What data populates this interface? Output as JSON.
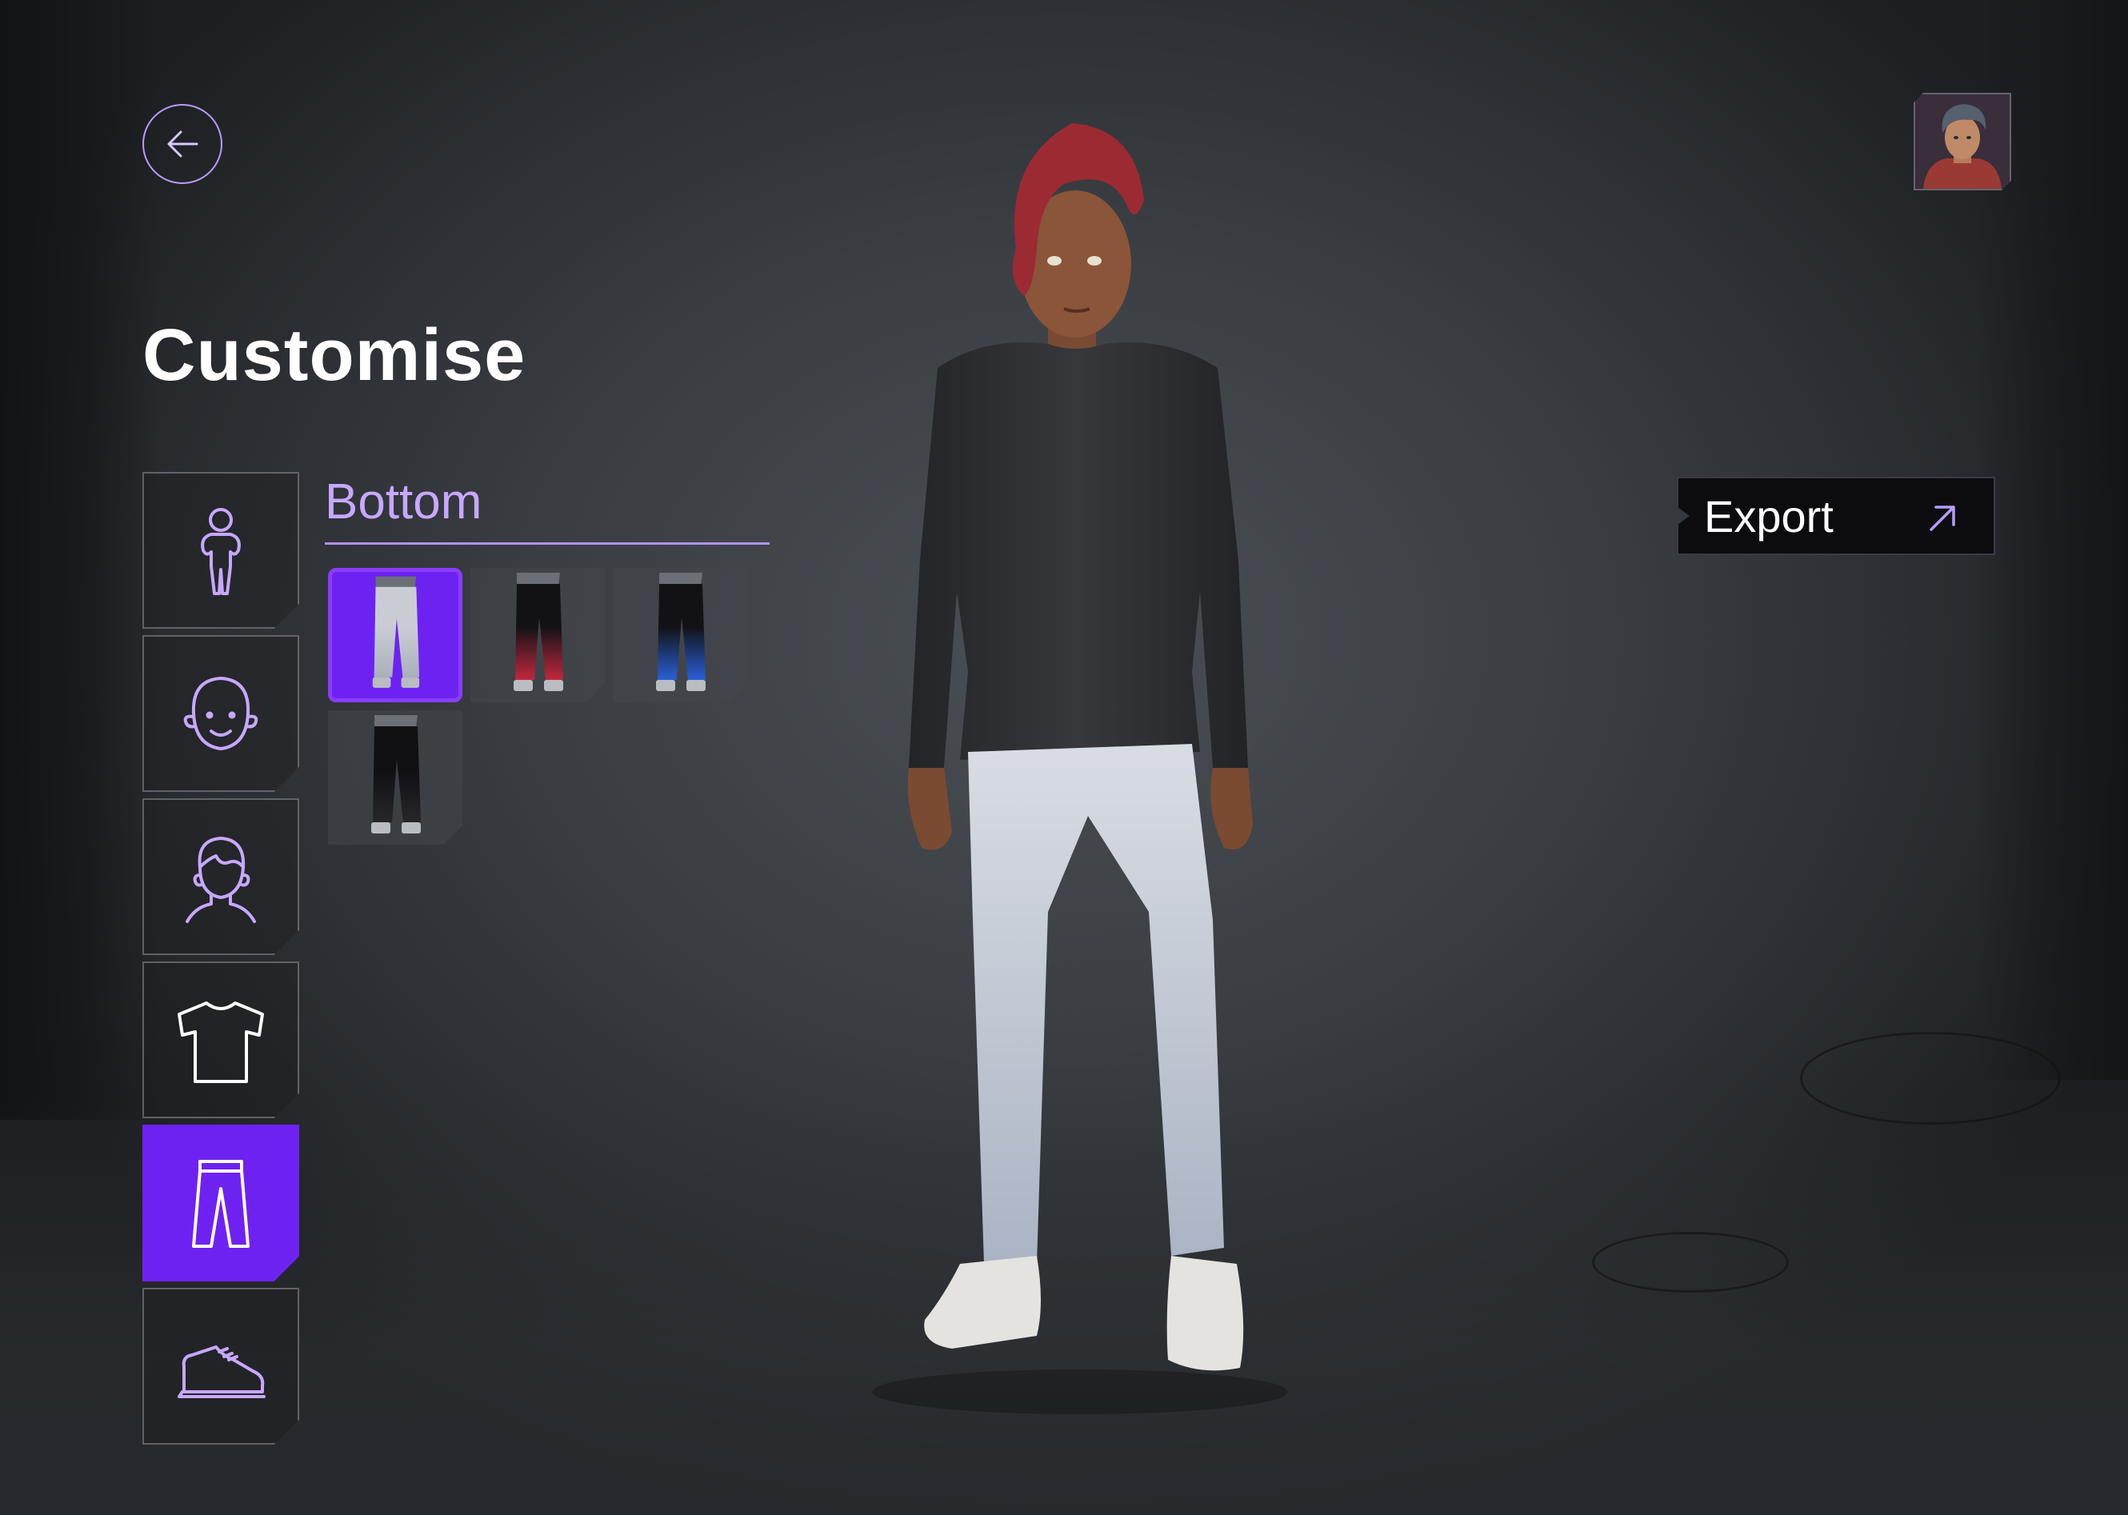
{
  "header": {
    "title": "Customise",
    "back_icon": "arrow-left-icon"
  },
  "categories": [
    {
      "id": "body",
      "icon": "body-icon",
      "active": false
    },
    {
      "id": "face",
      "icon": "face-icon",
      "active": false
    },
    {
      "id": "hair",
      "icon": "hair-icon",
      "active": false
    },
    {
      "id": "top",
      "icon": "tshirt-icon",
      "active": false
    },
    {
      "id": "bottom",
      "icon": "pants-icon",
      "active": true
    },
    {
      "id": "footwear",
      "icon": "shoe-icon",
      "active": false
    }
  ],
  "panel": {
    "section_label": "Bottom",
    "options": [
      {
        "id": "light-grey-pants",
        "selected": true,
        "pant_color": "#c9cdd3",
        "accent_color": "#a9b0bb"
      },
      {
        "id": "black-red-fade-leggings",
        "selected": false,
        "pant_color": "#121216",
        "accent_color": "#c0283d"
      },
      {
        "id": "black-blue-fade-leggings",
        "selected": false,
        "pant_color": "#121216",
        "accent_color": "#2a5fd6"
      },
      {
        "id": "black-leggings",
        "selected": false,
        "pant_color": "#101013",
        "accent_color": "#26262b"
      }
    ]
  },
  "export": {
    "label": "Export",
    "icon": "arrow-up-right-icon"
  },
  "profile": {
    "avatar_icon": "user-avatar"
  },
  "colors": {
    "accent": "#6e22f2",
    "accent_light": "#c8a7ff",
    "outline": "#b89cff"
  }
}
